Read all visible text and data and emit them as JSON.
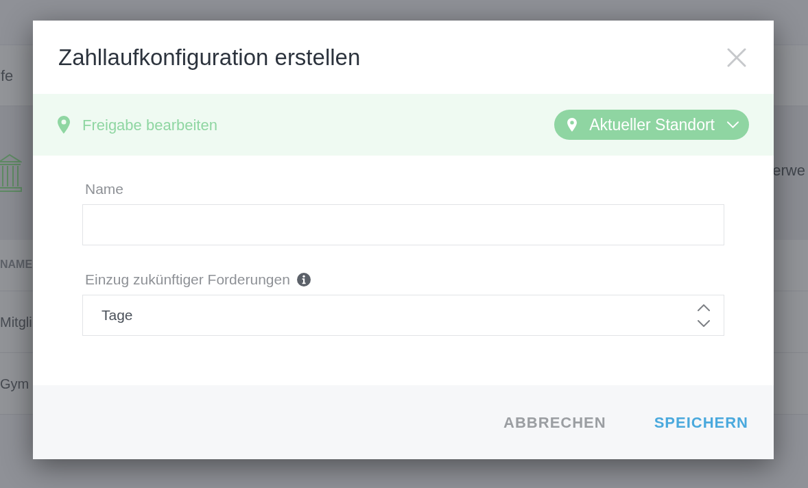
{
  "background_page": {
    "row_text": "fe",
    "banner_text": "erwe",
    "table": {
      "columns": [
        "NAME"
      ],
      "rows": [
        {
          "column_1": "Mitgli"
        },
        {
          "column_1": "Gym"
        }
      ]
    }
  },
  "dialog": {
    "title": "Zahllaufkonfiguration erstellen",
    "sharing_bar": {
      "label": "Freigabe bearbeiten",
      "location_button": "Aktueller Standort"
    },
    "fields": [
      {
        "kind": "text",
        "label": "Name",
        "info": false
      },
      {
        "kind": "select",
        "label": "Einzug zukünftiger Forderungen",
        "info": true,
        "value": "Tage"
      }
    ],
    "buttons": [
      {
        "kind": "secondary",
        "label": "ABBRECHEN"
      },
      {
        "kind": "primary",
        "label": "SPEICHERN"
      }
    ]
  }
}
